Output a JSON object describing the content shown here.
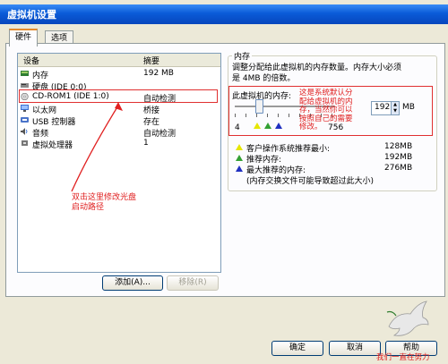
{
  "window": {
    "title": "虚拟机设置"
  },
  "tabs": [
    {
      "label": "硬件"
    },
    {
      "label": "选项"
    }
  ],
  "device_list": {
    "headers": {
      "device": "设备",
      "summary": "摘要"
    },
    "rows": [
      {
        "device": "内存",
        "summary": "192 MB",
        "icon": "memory-icon"
      },
      {
        "device": "硬盘 (IDE 0:0)",
        "summary": "",
        "icon": "hard-disk-icon"
      },
      {
        "device": "CD-ROM1 (IDE 1:0)",
        "summary": "自动检测",
        "icon": "cdrom-icon"
      },
      {
        "device": "以太网",
        "summary": "桥接",
        "icon": "network-icon"
      },
      {
        "device": "USB 控制器",
        "summary": "存在",
        "icon": "usb-icon"
      },
      {
        "device": "音频",
        "summary": "自动检测",
        "icon": "audio-icon"
      },
      {
        "device": "虚拟处理器",
        "summary": "1",
        "icon": "cpu-icon"
      }
    ]
  },
  "buttons": {
    "add": "添加(A)...",
    "remove": "移除(R)",
    "ok": "确定",
    "cancel": "取消",
    "help": "帮助"
  },
  "memory": {
    "group_title": "内存",
    "description": [
      "调整分配给此虚拟机的内存数量。内存大小必须",
      "是 4MB 的倍数。"
    ],
    "label": "此虚拟机的内存:",
    "value": "192",
    "unit": "MB",
    "slider_min": "4",
    "slider_max": "756",
    "slider_position": 0.24,
    "legend": [
      {
        "label": "客户操作系统推荐最小:",
        "value": "128MB",
        "color": "#e6e600"
      },
      {
        "label": "推荐内存:",
        "value": "192MB",
        "color": "#33a033"
      },
      {
        "label": "最大推荐的内存:",
        "value": "276MB",
        "color": "#2030c0"
      }
    ],
    "note": "(内存交换文件可能导致超过此大小)"
  },
  "annotations": {
    "memory_note": [
      "这是系统默认分",
      "配给虚拟机的内",
      "存，当然你可以",
      "按照自己的需要",
      "修改。"
    ],
    "cdrom_note": [
      "双击这里修改光盘",
      "启动路径"
    ]
  },
  "watermark": "我们一直在努力",
  "colors": {
    "title_blue": "#0a5bd8",
    "annotation_red": "#e02020",
    "tab_highlight": "#e68b2c"
  }
}
